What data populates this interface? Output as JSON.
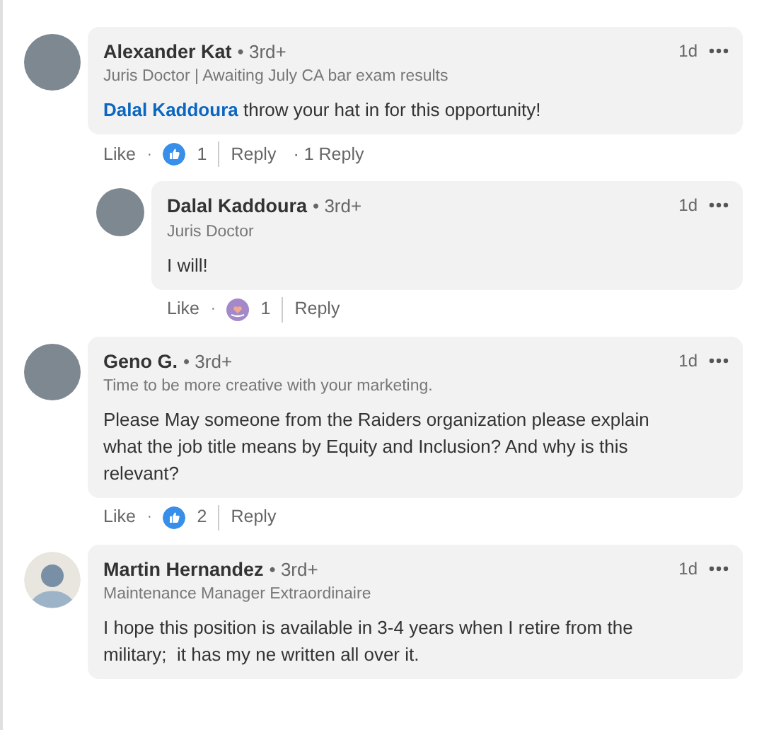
{
  "comments": [
    {
      "name": "Alexander Kat",
      "degree": "• 3rd+",
      "headline": "Juris Doctor | Awaiting July CA bar exam results",
      "time": "1d",
      "text": "throw your hat in for this opportunity!",
      "mention": "Dalal Kaddoura",
      "avatar": {
        "kind": "photo"
      },
      "like": "Like",
      "separator": "·",
      "reactions": [
        {
          "kind": "like"
        }
      ],
      "count": "1",
      "reply": "Reply",
      "replies_count": "· 1 Reply",
      "children": [
        {
          "name": "Dalal Kaddoura",
          "degree": "• 3rd+",
          "headline": "Juris Doctor",
          "time": "1d",
          "text": "I will!",
          "avatar": {
            "kind": "photo"
          },
          "like": "Like",
          "separator": "·",
          "reactions": [
            {
              "kind": "support"
            }
          ],
          "count": "1",
          "reply": "Reply"
        }
      ]
    },
    {
      "name": "Geno G.",
      "degree": "• 3rd+",
      "headline": "Time to be more creative with your marketing.",
      "time": "1d",
      "text": "Please May someone from the Raiders organization please explain what the job title means by Equity and Inclusion? And why is this relevant?",
      "avatar": {
        "kind": "photo"
      },
      "like": "Like",
      "separator": "·",
      "reactions": [
        {
          "kind": "like"
        }
      ],
      "count": "2",
      "reply": "Reply"
    },
    {
      "name": "Martin Hernandez",
      "degree": "• 3rd+",
      "headline": "Maintenance Manager Extraordinaire",
      "time": "1d",
      "text": "I hope this position is available in 3-4 years when I retire from the military;  it has my ne written all over it.",
      "avatar": {
        "kind": "default"
      }
    }
  ]
}
